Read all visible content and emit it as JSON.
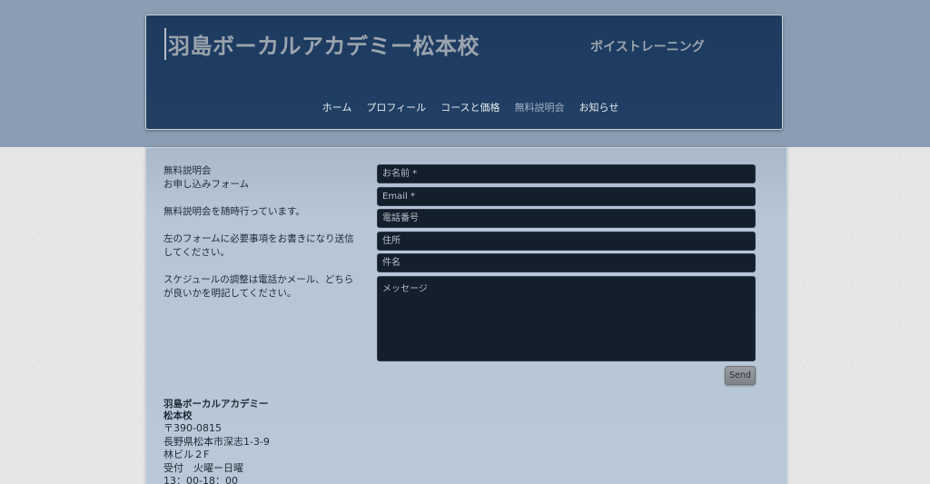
{
  "header": {
    "title": "羽島ボーカルアカデミー松本校",
    "subtitle": "ボイストレーニング",
    "nav": [
      {
        "label": "ホーム",
        "active": false
      },
      {
        "label": "プロフィール",
        "active": false
      },
      {
        "label": "コースと価格",
        "active": false
      },
      {
        "label": "無料説明会",
        "active": true
      },
      {
        "label": "お知らせ",
        "active": false
      }
    ]
  },
  "intro": {
    "heading_line1": "無料説明会",
    "heading_line2": "お申し込みフォーム",
    "para1": "無料説明会を随時行っています。",
    "para2": "左のフォームに必要事項をお書きになり送信してください。",
    "para3": "スケジュールの調整は電話かメール、どちらが良いかを明記してください。"
  },
  "form": {
    "name_placeholder": "お名前 *",
    "email_placeholder": "Email *",
    "phone_placeholder": "電話番号",
    "address_placeholder": "住所",
    "subject_placeholder": "件名",
    "message_placeholder": "メッセージ",
    "send_label": "Send"
  },
  "address": {
    "name_line1": "羽島ボーカルアカデミー",
    "name_line2": "松本校",
    "postal": "〒390-0815",
    "street": "長野県松本市深志1-3-9",
    "building": "林ビル２F",
    "reception": "受付　火曜ー日曜",
    "hours": "13：00-18：00"
  },
  "colors": {
    "header_bg": "#1e3a5f",
    "top_band": "#8a9db3",
    "content_bg": "#b6c6d6",
    "field_bg": "#141f2c"
  }
}
